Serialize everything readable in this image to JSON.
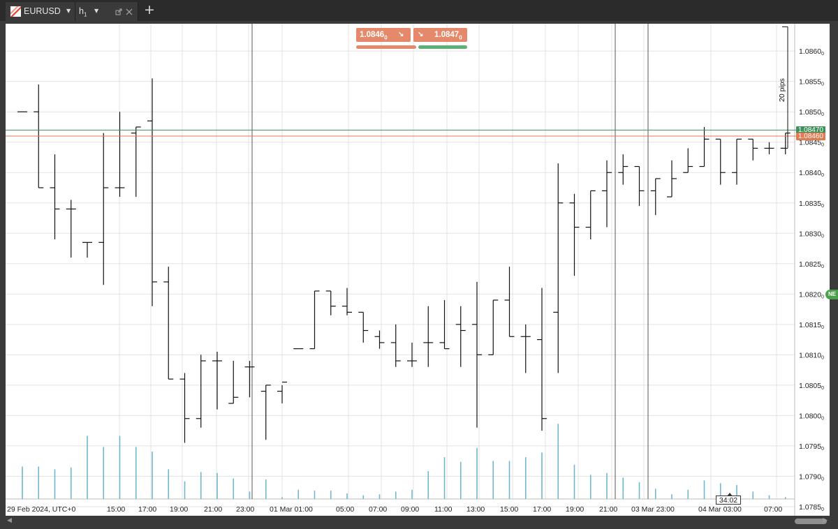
{
  "window": {
    "tabs": [
      {
        "symbol": "EURUSD"
      },
      {
        "timeframe": "h",
        "timeframe_sub": "1"
      }
    ]
  },
  "quote": {
    "sell_price_main": "1.0846",
    "sell_price_frac": "0",
    "buy_price_main": "1.0847",
    "buy_price_frac": "0"
  },
  "measure_label": "20 pips",
  "price_pills": {
    "ask": "1.08470",
    "bid": "1.08460"
  },
  "new_badge": "NE",
  "countdown": "34:02",
  "colors": {
    "sell": "#e6896a",
    "buy": "#5bb074",
    "ask_line": "#3f8f5b",
    "bid_line": "#e07a50",
    "volume": "#6db7cf",
    "bars": "#111111",
    "grid": "#e3e3e3"
  },
  "icons": {
    "logo": "ctrader-logo-icon",
    "dropdown": "chevron-down-icon",
    "detach": "detach-icon",
    "close": "close-icon",
    "add": "plus-icon"
  },
  "chart_data": {
    "type": "ohlc",
    "symbol": "EURUSD",
    "timeframe": "h1",
    "ylim": [
      1.07835,
      1.08645
    ],
    "grid": true,
    "y_ticks": [
      {
        "main": "1.0860",
        "sub": "0"
      },
      {
        "main": "1.0855",
        "sub": "0"
      },
      {
        "main": "1.0850",
        "sub": "0"
      },
      {
        "main": "1.0845",
        "sub": "0"
      },
      {
        "main": "1.0840",
        "sub": "0"
      },
      {
        "main": "1.0835",
        "sub": "0"
      },
      {
        "main": "1.0830",
        "sub": "0"
      },
      {
        "main": "1.0825",
        "sub": "0"
      },
      {
        "main": "1.0820",
        "sub": "0"
      },
      {
        "main": "1.0815",
        "sub": "0"
      },
      {
        "main": "1.0810",
        "sub": "0"
      },
      {
        "main": "1.0805",
        "sub": "0"
      },
      {
        "main": "1.0800",
        "sub": "0"
      },
      {
        "main": "1.0795",
        "sub": "0"
      },
      {
        "main": "1.0790",
        "sub": "0"
      },
      {
        "main": "1.0785",
        "sub": "0"
      }
    ],
    "x_labels": [
      "29 Feb 2024, UTC+0",
      "15:00",
      "17:00",
      "19:00",
      "21:00",
      "23:00",
      "01 Mar 01:00",
      "05:00",
      "07:00",
      "09:00",
      "11:00",
      "13:00",
      "15:00",
      "17:00",
      "19:00",
      "21:00",
      "03 Mar 23:00",
      "04 Mar 03:00",
      "07:00"
    ],
    "separator_bars": [
      15,
      36,
      38
    ],
    "ask": 1.0847,
    "bid": 1.0846,
    "bars": [
      {
        "o": 1.085,
        "h": 1.085,
        "l": 1.085,
        "c": 1.085,
        "v": 0.35
      },
      {
        "o": 1.085,
        "h": 1.08545,
        "l": 1.08375,
        "c": 1.08375,
        "v": 0.35
      },
      {
        "o": 1.08375,
        "h": 1.0843,
        "l": 1.0829,
        "c": 1.0834,
        "v": 0.32
      },
      {
        "o": 1.0834,
        "h": 1.08355,
        "l": 1.0826,
        "c": 1.0834,
        "v": 0.34
      },
      {
        "o": 1.08285,
        "h": 1.08285,
        "l": 1.0826,
        "c": 1.08285,
        "v": 0.68
      },
      {
        "o": 1.08285,
        "h": 1.08465,
        "l": 1.08215,
        "c": 1.08375,
        "v": 0.56
      },
      {
        "o": 1.08375,
        "h": 1.085,
        "l": 1.0836,
        "c": 1.08375,
        "v": 0.68
      },
      {
        "o": 1.08465,
        "h": 1.08475,
        "l": 1.0836,
        "c": 1.08475,
        "v": 0.56
      },
      {
        "o": 1.08485,
        "h": 1.08555,
        "l": 1.0818,
        "c": 1.0822,
        "v": 0.51
      },
      {
        "o": 1.0822,
        "h": 1.08245,
        "l": 1.0806,
        "c": 1.0806,
        "v": 0.32
      },
      {
        "o": 1.0806,
        "h": 1.0807,
        "l": 1.07955,
        "c": 1.07995,
        "v": 0.19
      },
      {
        "o": 1.07995,
        "h": 1.081,
        "l": 1.0798,
        "c": 1.0809,
        "v": 0.29
      },
      {
        "o": 1.0809,
        "h": 1.08105,
        "l": 1.0801,
        "c": 1.0809,
        "v": 0.28
      },
      {
        "o": 1.0802,
        "h": 1.0809,
        "l": 1.0802,
        "c": 1.0803,
        "v": 0.22
      },
      {
        "o": 1.0808,
        "h": 1.0809,
        "l": 1.0803,
        "c": 1.0808,
        "v": 0.08
      },
      {
        "o": 1.0804,
        "h": 1.0805,
        "l": 1.0796,
        "c": 1.0805,
        "v": 0.21
      },
      {
        "o": 1.0804,
        "h": 1.0805,
        "l": 1.0802,
        "c": 1.08055,
        "v": 0.02
      },
      {
        "o": 1.0811,
        "h": 1.0811,
        "l": 1.0811,
        "c": 1.0811,
        "v": 0.1
      },
      {
        "o": 1.0811,
        "h": 1.08205,
        "l": 1.0811,
        "c": 1.08205,
        "v": 0.09
      },
      {
        "o": 1.08205,
        "h": 1.08205,
        "l": 1.08165,
        "c": 1.0818,
        "v": 0.09
      },
      {
        "o": 1.0818,
        "h": 1.0821,
        "l": 1.08165,
        "c": 1.0817,
        "v": 0.06
      },
      {
        "o": 1.0817,
        "h": 1.0817,
        "l": 1.0812,
        "c": 1.0814,
        "v": 0.04
      },
      {
        "o": 1.0813,
        "h": 1.0814,
        "l": 1.0811,
        "c": 1.0812,
        "v": 0.05
      },
      {
        "o": 1.0812,
        "h": 1.0815,
        "l": 1.0808,
        "c": 1.0809,
        "v": 0.08
      },
      {
        "o": 1.0809,
        "h": 1.0812,
        "l": 1.0808,
        "c": 1.0809,
        "v": 0.1
      },
      {
        "o": 1.0812,
        "h": 1.0818,
        "l": 1.0808,
        "c": 1.0812,
        "v": 0.3
      },
      {
        "o": 1.0812,
        "h": 1.0819,
        "l": 1.0811,
        "c": 1.0811,
        "v": 0.45
      },
      {
        "o": 1.0815,
        "h": 1.0818,
        "l": 1.0808,
        "c": 1.0814,
        "v": 0.4
      },
      {
        "o": 1.0815,
        "h": 1.0822,
        "l": 1.0798,
        "c": 1.081,
        "v": 0.55
      },
      {
        "o": 1.081,
        "h": 1.0819,
        "l": 1.081,
        "c": 1.0819,
        "v": 0.41
      },
      {
        "o": 1.0819,
        "h": 1.08245,
        "l": 1.0813,
        "c": 1.0813,
        "v": 0.41
      },
      {
        "o": 1.0813,
        "h": 1.0815,
        "l": 1.0807,
        "c": 1.0813,
        "v": 0.45
      },
      {
        "o": 1.08125,
        "h": 1.0821,
        "l": 1.07975,
        "c": 1.07995,
        "v": 0.5
      },
      {
        "o": 1.0817,
        "h": 1.08415,
        "l": 1.0807,
        "c": 1.0835,
        "v": 0.81
      },
      {
        "o": 1.0835,
        "h": 1.08365,
        "l": 1.0823,
        "c": 1.0831,
        "v": 0.37
      },
      {
        "o": 1.0831,
        "h": 1.0837,
        "l": 1.0829,
        "c": 1.0837,
        "v": 0.26
      },
      {
        "o": 1.0837,
        "h": 1.0842,
        "l": 1.0831,
        "c": 1.084,
        "v": 0.28
      },
      {
        "o": 1.084,
        "h": 1.0843,
        "l": 1.0838,
        "c": 1.0841,
        "v": 0.23
      },
      {
        "o": 1.0841,
        "h": 1.0841,
        "l": 1.08345,
        "c": 1.0837,
        "v": 0.18
      },
      {
        "o": 1.0837,
        "h": 1.0839,
        "l": 1.0833,
        "c": 1.0839,
        "v": 0.11
      },
      {
        "o": 1.0836,
        "h": 1.0842,
        "l": 1.0836,
        "c": 1.0839,
        "v": 0.05
      },
      {
        "o": 1.084,
        "h": 1.0844,
        "l": 1.084,
        "c": 1.0841,
        "v": 0.1
      },
      {
        "o": 1.0841,
        "h": 1.08475,
        "l": 1.0841,
        "c": 1.08455,
        "v": 0.2
      },
      {
        "o": 1.08455,
        "h": 1.08455,
        "l": 1.0838,
        "c": 1.084,
        "v": 0.17
      },
      {
        "o": 1.084,
        "h": 1.08455,
        "l": 1.0838,
        "c": 1.08455,
        "v": 0.15
      },
      {
        "o": 1.08455,
        "h": 1.08455,
        "l": 1.0842,
        "c": 1.0844,
        "v": 0.08
      },
      {
        "o": 1.0844,
        "h": 1.0845,
        "l": 1.0843,
        "c": 1.0844,
        "v": 0.04
      },
      {
        "o": 1.0844,
        "h": 1.08465,
        "l": 1.0843,
        "c": 1.08465,
        "v": 0.02
      }
    ]
  }
}
